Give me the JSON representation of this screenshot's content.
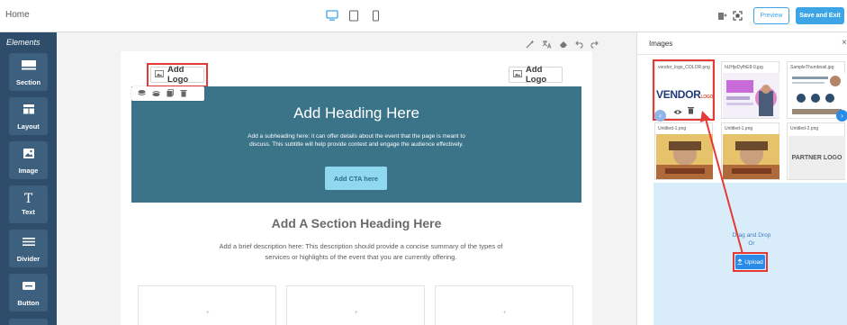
{
  "topbar": {
    "breadcrumb": "Home",
    "devices": [
      "desktop-icon",
      "tablet-icon",
      "mobile-icon"
    ],
    "preview_label": "Preview",
    "save_label": "Save and Exit"
  },
  "sidebar": {
    "title": "Elements",
    "items": [
      {
        "label": "Section",
        "icon": "section-icon"
      },
      {
        "label": "Layout",
        "icon": "layout-icon"
      },
      {
        "label": "Image",
        "icon": "image-icon"
      },
      {
        "label": "Text",
        "icon": "text-icon"
      },
      {
        "label": "Divider",
        "icon": "divider-icon"
      },
      {
        "label": "Button",
        "icon": "button-icon"
      }
    ]
  },
  "canvas": {
    "logo_left": "Add Logo",
    "logo_right": "Add Logo",
    "hero": {
      "heading": "Add Heading Here",
      "subheading": "Add a subheading here: it can offer details about the event that the page is meant to discuss. This subtitle will help provide context and engage the audience effectively.",
      "cta": "Add CTA here"
    },
    "section": {
      "heading": "Add A Section Heading Here",
      "description": "Add a brief description here: This description should provide a concise summary of the types of services or highlights of the event that you are currently offering."
    },
    "cards": [
      "+",
      "+",
      "+"
    ]
  },
  "images_panel": {
    "title": "Images",
    "close": "×",
    "thumbnails": [
      {
        "name": "vendor_logo_COLOR.png",
        "text": "VENDOR",
        "suffix": "LOGO"
      },
      {
        "name": "hUHjeDyfhE8-0.jpg"
      },
      {
        "name": "SampleThumbnail.jpg"
      },
      {
        "name": "Untitled-1.png"
      },
      {
        "name": "Untitled-1.png"
      },
      {
        "name": "Untitled-2.png",
        "text": "PARTNER LOGO"
      }
    ],
    "drop_text": "Drag and Drop\nOr",
    "upload_label": "Upload"
  },
  "colors": {
    "sidebar_bg": "#2e4d6b",
    "hero_bg": "#3b7389",
    "accent": "#3da5e6",
    "highlight": "#e53935"
  }
}
